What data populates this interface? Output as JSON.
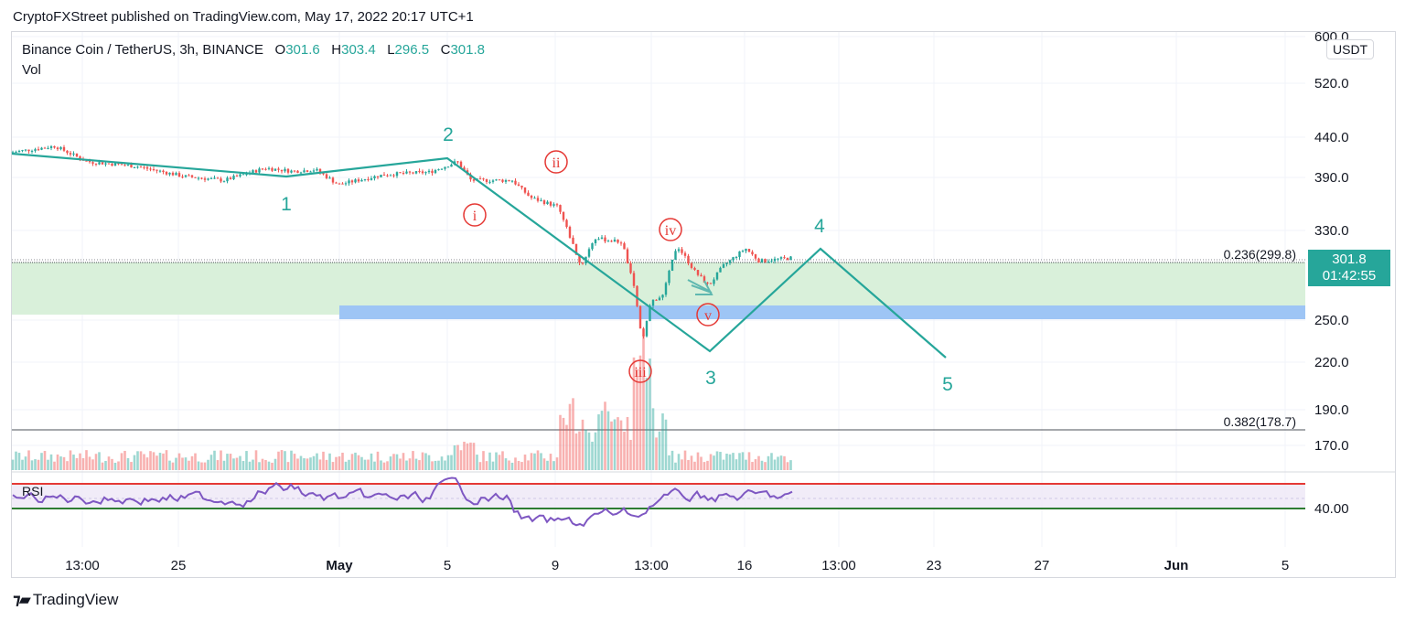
{
  "publisher_line": "CryptoFXStreet published on TradingView.com, May 17, 2022 20:17 UTC+1",
  "legend": {
    "pair": "Binance Coin / TetherUS, 3h, BINANCE",
    "o_label": "O",
    "o": "301.6",
    "h_label": "H",
    "h": "303.4",
    "l_label": "L",
    "l": "296.5",
    "c_label": "C",
    "c": "301.8",
    "vol": "Vol"
  },
  "unit": "USDT",
  "price_badge": {
    "price": "301.8",
    "countdown": "01:42:55"
  },
  "rsi_label": "RSI",
  "footer": {
    "brand": "TradingView"
  },
  "colors": {
    "up": "#26a69a",
    "down": "#ef5350",
    "wave": "#26a69a",
    "subwave": "#e53935",
    "fib_zone": "#d9f0da",
    "support_zone": "#9ec5f5",
    "rsi_line": "#7e57c2",
    "rsi_upper": "#e53935",
    "rsi_lower": "#2e7d32"
  },
  "chart_data": {
    "type": "candlestick",
    "price_axis_ticks": [
      "600.0",
      "520.0",
      "440.0",
      "390.0",
      "330.0",
      "250.0",
      "220.0",
      "190.0",
      "170.0"
    ],
    "time_axis_ticks": [
      "13:00",
      "25",
      "May",
      "5",
      "9",
      "13:00",
      "16",
      "13:00",
      "23",
      "27",
      "Jun",
      "5"
    ],
    "fib_levels": [
      {
        "label": "0.236(299.8)",
        "value": 299.8
      },
      {
        "label": "0.382(178.7)",
        "value": 178.7
      }
    ],
    "elliott_waves": {
      "primary": [
        {
          "label": "1",
          "price": 388
        },
        {
          "label": "2",
          "price": 415
        },
        {
          "label": "3",
          "price": 230
        },
        {
          "label": "4",
          "price": 310
        },
        {
          "label": "5",
          "price": 228
        }
      ],
      "sub_waves": [
        "i",
        "ii",
        "iii",
        "iv",
        "v"
      ]
    },
    "last_price": 301.8,
    "rsi": {
      "axis_label": "40.00",
      "upper": 70,
      "lower": 30
    }
  }
}
